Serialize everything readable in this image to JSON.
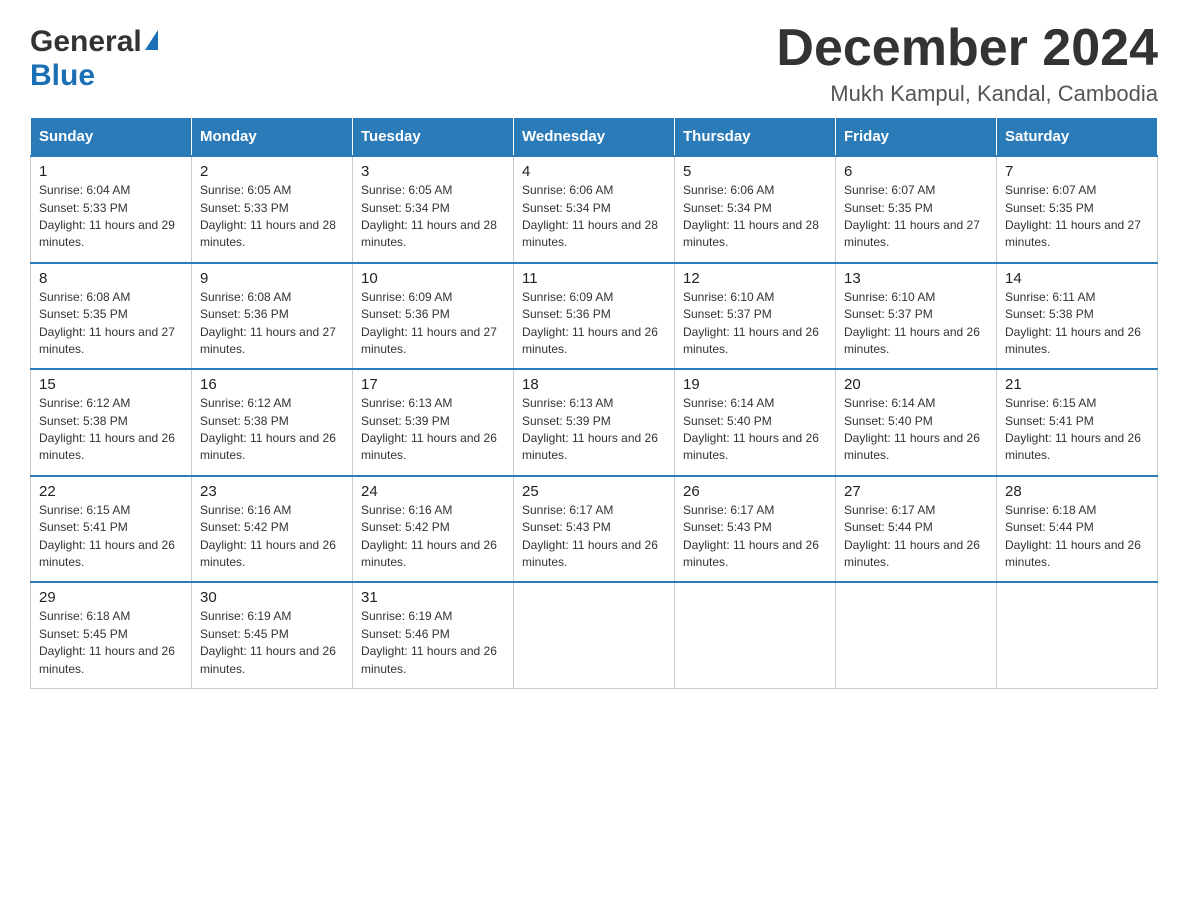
{
  "header": {
    "logo_general": "General",
    "logo_blue": "Blue",
    "month_year": "December 2024",
    "location": "Mukh Kampul, Kandal, Cambodia"
  },
  "weekdays": [
    "Sunday",
    "Monday",
    "Tuesday",
    "Wednesday",
    "Thursday",
    "Friday",
    "Saturday"
  ],
  "weeks": [
    [
      {
        "day": "1",
        "sunrise": "6:04 AM",
        "sunset": "5:33 PM",
        "daylight": "11 hours and 29 minutes."
      },
      {
        "day": "2",
        "sunrise": "6:05 AM",
        "sunset": "5:33 PM",
        "daylight": "11 hours and 28 minutes."
      },
      {
        "day": "3",
        "sunrise": "6:05 AM",
        "sunset": "5:34 PM",
        "daylight": "11 hours and 28 minutes."
      },
      {
        "day": "4",
        "sunrise": "6:06 AM",
        "sunset": "5:34 PM",
        "daylight": "11 hours and 28 minutes."
      },
      {
        "day": "5",
        "sunrise": "6:06 AM",
        "sunset": "5:34 PM",
        "daylight": "11 hours and 28 minutes."
      },
      {
        "day": "6",
        "sunrise": "6:07 AM",
        "sunset": "5:35 PM",
        "daylight": "11 hours and 27 minutes."
      },
      {
        "day": "7",
        "sunrise": "6:07 AM",
        "sunset": "5:35 PM",
        "daylight": "11 hours and 27 minutes."
      }
    ],
    [
      {
        "day": "8",
        "sunrise": "6:08 AM",
        "sunset": "5:35 PM",
        "daylight": "11 hours and 27 minutes."
      },
      {
        "day": "9",
        "sunrise": "6:08 AM",
        "sunset": "5:36 PM",
        "daylight": "11 hours and 27 minutes."
      },
      {
        "day": "10",
        "sunrise": "6:09 AM",
        "sunset": "5:36 PM",
        "daylight": "11 hours and 27 minutes."
      },
      {
        "day": "11",
        "sunrise": "6:09 AM",
        "sunset": "5:36 PM",
        "daylight": "11 hours and 26 minutes."
      },
      {
        "day": "12",
        "sunrise": "6:10 AM",
        "sunset": "5:37 PM",
        "daylight": "11 hours and 26 minutes."
      },
      {
        "day": "13",
        "sunrise": "6:10 AM",
        "sunset": "5:37 PM",
        "daylight": "11 hours and 26 minutes."
      },
      {
        "day": "14",
        "sunrise": "6:11 AM",
        "sunset": "5:38 PM",
        "daylight": "11 hours and 26 minutes."
      }
    ],
    [
      {
        "day": "15",
        "sunrise": "6:12 AM",
        "sunset": "5:38 PM",
        "daylight": "11 hours and 26 minutes."
      },
      {
        "day": "16",
        "sunrise": "6:12 AM",
        "sunset": "5:38 PM",
        "daylight": "11 hours and 26 minutes."
      },
      {
        "day": "17",
        "sunrise": "6:13 AM",
        "sunset": "5:39 PM",
        "daylight": "11 hours and 26 minutes."
      },
      {
        "day": "18",
        "sunrise": "6:13 AM",
        "sunset": "5:39 PM",
        "daylight": "11 hours and 26 minutes."
      },
      {
        "day": "19",
        "sunrise": "6:14 AM",
        "sunset": "5:40 PM",
        "daylight": "11 hours and 26 minutes."
      },
      {
        "day": "20",
        "sunrise": "6:14 AM",
        "sunset": "5:40 PM",
        "daylight": "11 hours and 26 minutes."
      },
      {
        "day": "21",
        "sunrise": "6:15 AM",
        "sunset": "5:41 PM",
        "daylight": "11 hours and 26 minutes."
      }
    ],
    [
      {
        "day": "22",
        "sunrise": "6:15 AM",
        "sunset": "5:41 PM",
        "daylight": "11 hours and 26 minutes."
      },
      {
        "day": "23",
        "sunrise": "6:16 AM",
        "sunset": "5:42 PM",
        "daylight": "11 hours and 26 minutes."
      },
      {
        "day": "24",
        "sunrise": "6:16 AM",
        "sunset": "5:42 PM",
        "daylight": "11 hours and 26 minutes."
      },
      {
        "day": "25",
        "sunrise": "6:17 AM",
        "sunset": "5:43 PM",
        "daylight": "11 hours and 26 minutes."
      },
      {
        "day": "26",
        "sunrise": "6:17 AM",
        "sunset": "5:43 PM",
        "daylight": "11 hours and 26 minutes."
      },
      {
        "day": "27",
        "sunrise": "6:17 AM",
        "sunset": "5:44 PM",
        "daylight": "11 hours and 26 minutes."
      },
      {
        "day": "28",
        "sunrise": "6:18 AM",
        "sunset": "5:44 PM",
        "daylight": "11 hours and 26 minutes."
      }
    ],
    [
      {
        "day": "29",
        "sunrise": "6:18 AM",
        "sunset": "5:45 PM",
        "daylight": "11 hours and 26 minutes."
      },
      {
        "day": "30",
        "sunrise": "6:19 AM",
        "sunset": "5:45 PM",
        "daylight": "11 hours and 26 minutes."
      },
      {
        "day": "31",
        "sunrise": "6:19 AM",
        "sunset": "5:46 PM",
        "daylight": "11 hours and 26 minutes."
      },
      null,
      null,
      null,
      null
    ]
  ],
  "labels": {
    "sunrise_prefix": "Sunrise: ",
    "sunset_prefix": "Sunset: ",
    "daylight_prefix": "Daylight: "
  }
}
